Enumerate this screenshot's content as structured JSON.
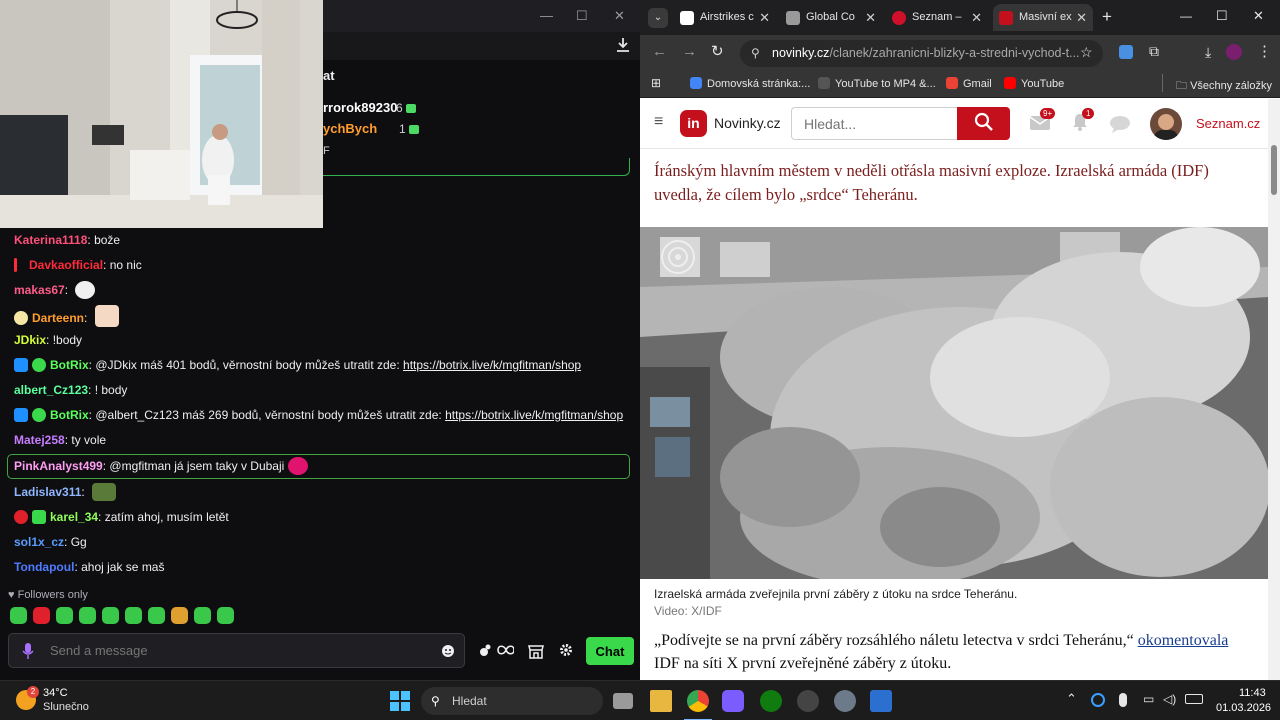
{
  "chat": {
    "title": "at",
    "gifters": [
      {
        "name": "rrorok89230",
        "count": "6",
        "color": "#ffffff"
      },
      {
        "name": "ychBych",
        "count": "1",
        "color": "#ff9d2e"
      }
    ],
    "gift_partial": "F",
    "messages": [
      {
        "user": "Katerina1118",
        "color": "#ff4f7b",
        "text": "bože"
      },
      {
        "user": "Davkaofficial",
        "color": "#ff2a3a",
        "text": "no nic"
      },
      {
        "user": "makas67",
        "color": "#ff5c8a",
        "text": ""
      },
      {
        "user": "Darteenn",
        "color": "#ff9d2e",
        "text": ""
      },
      {
        "user": "JDkix",
        "color": "#d3ff3a",
        "text": "!body"
      },
      {
        "user": "BotRix",
        "color": "#5bff5b",
        "text": "@JDkix máš 401 bodů, věrnostní body můžeš utratit zde: ",
        "link": "https://botrix.live/k/mgfitman/shop"
      },
      {
        "user": "albert_Cz123",
        "color": "#5bff9e",
        "text": "! body"
      },
      {
        "user": "BotRix",
        "color": "#5bff5b",
        "text": "@albert_Cz123 máš 269 bodů, věrnostní body můžeš utratit zde: ",
        "link": "https://botrix.live/k/mgfitman/shop"
      },
      {
        "user": "Matej258",
        "color": "#c77dff",
        "text": "ty vole"
      },
      {
        "user": "PinkAnalyst499",
        "color": "#ff9df2",
        "text": "@mgfitman já jsem taky v Dubaji"
      },
      {
        "user": "Ladislav311",
        "color": "#8fb6ff",
        "text": ""
      },
      {
        "user": "karel_34",
        "color": "#8dff5b",
        "text": "zatím ahoj, musím letět"
      },
      {
        "user": "sol1x_cz",
        "color": "#5b9dff",
        "text": "Gg"
      },
      {
        "user": "Tondapoul",
        "color": "#4f7bff",
        "text": "ahoj jak se maš"
      }
    ],
    "followers_only": "Followers only",
    "input_placeholder": "Send a message",
    "chat_button": "Chat"
  },
  "browser": {
    "tabs": [
      {
        "label": "Airstrikes c",
        "fav": "#ffffff"
      },
      {
        "label": "Global Co",
        "fav": "#9a9a9a"
      },
      {
        "label": "Seznam – ",
        "fav": "#d0102a"
      },
      {
        "label": "Masivní ex",
        "fav": "#c4101c"
      }
    ],
    "url_host": "novinky.cz",
    "url_path": "/clanek/zahranicni-blizky-a-stredni-vychod-t...",
    "bookmarks": [
      {
        "label": "Domovská stránka:...",
        "color": "#4285f4"
      },
      {
        "label": "YouTube to MP4 &...",
        "color": "#222222"
      },
      {
        "label": "Gmail",
        "color": "#ea4335"
      },
      {
        "label": "YouTube",
        "color": "#ff0000"
      }
    ],
    "all_bookmarks": "Všechny záložky"
  },
  "page": {
    "logo_mark": "in",
    "logo_text": "Novinky.cz",
    "search_placeholder": "Hledat...",
    "mail_badge": "9+",
    "notif_badge": "1",
    "seznam": "Seznam.cz",
    "lead": "Íránským hlavním městem v neděli otřásla masivní exploze. Izraelská armáda (IDF) uvedla, že cílem bylo „srdce“ Teheránu.",
    "caption": "Izraelská armáda zveřejnila první záběry z útoku na srdce Teheránu.",
    "credit": "Video: X/IDF",
    "body_before": "„Podívejte se na první záběry rozsáhlého náletu letectva v srdci Teheránu,“ ",
    "body_link": "okomentovala",
    "body_after": " IDF na síti X první zveřejněné záběry z útoku."
  },
  "taskbar": {
    "weather_badge": "2",
    "temp": "34°C",
    "weather": "Slunečno",
    "search": "Hledat",
    "time": "11:43",
    "date": "01.03.2026"
  },
  "colors": {
    "accent_green": "#3ad94b",
    "brand_red": "#c4101c"
  }
}
